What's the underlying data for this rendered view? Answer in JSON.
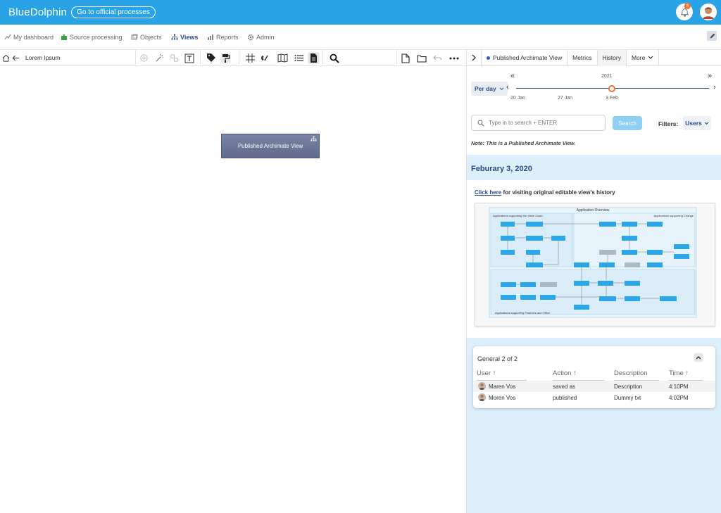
{
  "app": {
    "brand": "BlueDolphin",
    "official_button": "Go to official processes",
    "notification_count": "8"
  },
  "nav": {
    "items": [
      {
        "label": "My dashboard",
        "icon": "chart-icon"
      },
      {
        "label": "Source processing",
        "icon": "puzzle-icon"
      },
      {
        "label": "Objects",
        "icon": "objects-icon"
      },
      {
        "label": "Views",
        "icon": "hierarchy-icon"
      },
      {
        "label": "Reports",
        "icon": "bar-chart-icon"
      },
      {
        "label": "Admin",
        "icon": "gear-icon"
      }
    ],
    "active": "Views"
  },
  "toolbar": {
    "view_name": "Lorem Ipsum"
  },
  "canvas": {
    "view_box_label": "Published Archimate View"
  },
  "panel": {
    "tabs": [
      "Published Archimate View",
      "Metrics",
      "History",
      "More"
    ],
    "active_tab": "History",
    "timeline": {
      "year": "2021",
      "dates": [
        "20 Jan",
        "27 Jan",
        "3 Feb"
      ],
      "period": "Per day"
    },
    "search": {
      "placeholder": "Type in to search + ENTER",
      "button": "Search"
    },
    "filters_label": "Filters:",
    "filters_value": "Users",
    "note": "Note: This is a Published Archimate View.",
    "history_date": "Feburary 3, 2020",
    "click_here": "Click here",
    "click_here_rest": " for visiting original editable view's history",
    "diagram": {
      "title": "Application Overview",
      "group_top_left": "Applications supporting the Value Chain",
      "group_top_right": "Applications supporting Change",
      "group_bottom": "Applications supporting Finances and Office"
    },
    "general": {
      "title": "General 2 of 2",
      "columns": [
        "User",
        "Action",
        "Description",
        "Time"
      ],
      "rows": [
        {
          "user": "Maren Vos",
          "action": "saved as",
          "description": "Description",
          "time": "4:10PM"
        },
        {
          "user": "Moren Vos",
          "action": "published",
          "description": "Dummy txt",
          "time": "4:02PM"
        }
      ]
    }
  },
  "colors": {
    "topbar": "#29a3e6",
    "accent_dark": "#2b4a8a",
    "timeline_marker": "#f07030",
    "history_bg": "#ddeffb",
    "search_button": "#8ecff3"
  }
}
